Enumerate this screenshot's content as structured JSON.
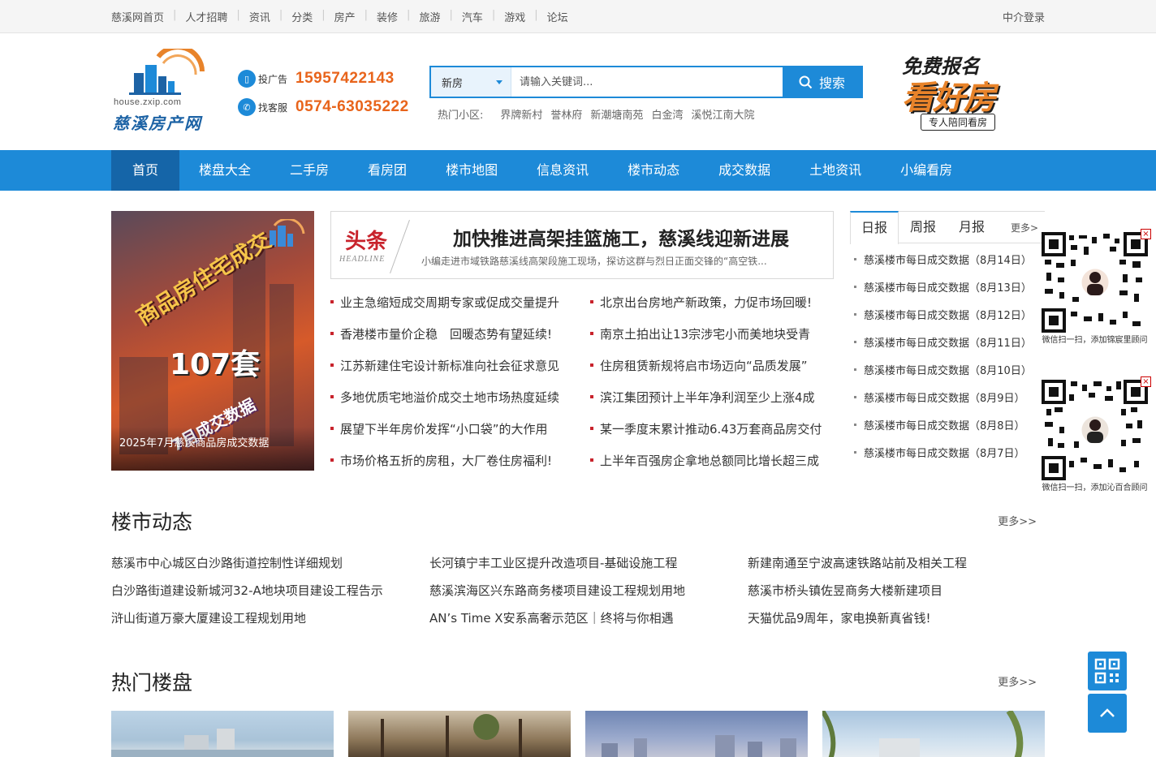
{
  "topbar": {
    "links": [
      "慈溪网首页",
      "人才招聘",
      "资讯",
      "分类",
      "房产",
      "装修",
      "旅游",
      "汽车",
      "游戏",
      "论坛"
    ],
    "login": "中介登录"
  },
  "logo": {
    "domain": "house.zxip.com",
    "name": "慈溪房产网"
  },
  "contact": {
    "ad_label": "投广告",
    "ad_phone": "15957422143",
    "service_label": "找客服",
    "service_phone": "0574-63035222"
  },
  "search": {
    "category": "新房",
    "placeholder": "请输入关键词...",
    "button": "搜索",
    "hot_label": "热门小区:",
    "hot_keywords": [
      "界牌新村",
      "誉林府",
      "新潮塘南苑",
      "白金湾",
      "溪悦江南大院"
    ]
  },
  "promo": {
    "line1": "免费报名",
    "line2": "看好房",
    "line3": "专人陪同看房"
  },
  "nav": {
    "items": [
      "首页",
      "楼盘大全",
      "二手房",
      "看房团",
      "楼市地图",
      "信息资讯",
      "楼市动态",
      "成交数据",
      "土地资讯",
      "小编看房"
    ]
  },
  "banner": {
    "arc_text": "商品房住宅成交",
    "big_number": "107套",
    "sub_text": "7月成交数据",
    "caption": "2025年7月慈溪商品房成交数据"
  },
  "headline": {
    "tag": "头条",
    "tag_en": "HEADLINE",
    "title": "加快推进高架挂篮施工，慈溪线迎新进展",
    "desc": "小编走进市域铁路慈溪线高架段施工现场，探访这群与烈日正面交锋的“高空铁..."
  },
  "news_left": [
    "业主急缩短成交周期专家或促成交量提升",
    "香港楼市量价企稳　回暖态势有望延续!",
    "江苏新建住宅设计新标准向社会征求意见",
    "多地优质宅地溢价成交土地市场热度延续",
    "展望下半年房价发挥“小口袋”的大作用",
    "市场价格五折的房租，大厂卷住房福利!"
  ],
  "news_right": [
    "北京出台房地产新政策，力促市场回暖!",
    "南京土拍出让13宗涉宅小而美地块受青",
    "住房租赁新规将启市场迈向“品质发展”",
    "滨江集团预计上半年净利润至少上涨4成",
    "某一季度末累计推动6.43万套商品房交付",
    "上半年百强房企拿地总额同比增长超三成"
  ],
  "reports": {
    "tabs": [
      "日报",
      "周报",
      "月报"
    ],
    "more": "更多>",
    "items": [
      "慈溪楼市每日成交数据（8月14日）",
      "慈溪楼市每日成交数据（8月13日）",
      "慈溪楼市每日成交数据（8月12日）",
      "慈溪楼市每日成交数据（8月11日）",
      "慈溪楼市每日成交数据（8月10日）",
      "慈溪楼市每日成交数据（8月9日）",
      "慈溪楼市每日成交数据（8月8日）",
      "慈溪楼市每日成交数据（8月7日）"
    ]
  },
  "qr": {
    "caption1": "微信扫一扫，添加锦宸里顾问",
    "caption2": "微信扫一扫，添加沁百合顾问",
    "close": "×"
  },
  "market": {
    "title": "楼市动态",
    "more": "更多>>",
    "col1": [
      "慈溪市中心城区白沙路街道控制性详细规划",
      "白沙路街道建设新城河32-A地块项目建设工程告示",
      "浒山街道万豪大厦建设工程规划用地"
    ],
    "col2": [
      "长河镇宁丰工业区提升改造项目-基础设施工程",
      "慈溪滨海区兴东路商务楼项目建设工程规划用地",
      "AN’s Time X安系高奢示范区｜终将与你相遇"
    ],
    "col3": [
      "新建南通至宁波高速铁路站前及相关工程",
      "慈溪市桥头镇佐昱商务大楼新建项目",
      "天猫优品9周年，家电换新真省钱!"
    ]
  },
  "hot": {
    "title": "热门楼盘",
    "more": "更多>>"
  },
  "colors": {
    "brand_blue": "#1d8ad8",
    "nav_active": "#1565a8",
    "phone_orange": "#e8641b",
    "headline_red": "#c8232c"
  }
}
